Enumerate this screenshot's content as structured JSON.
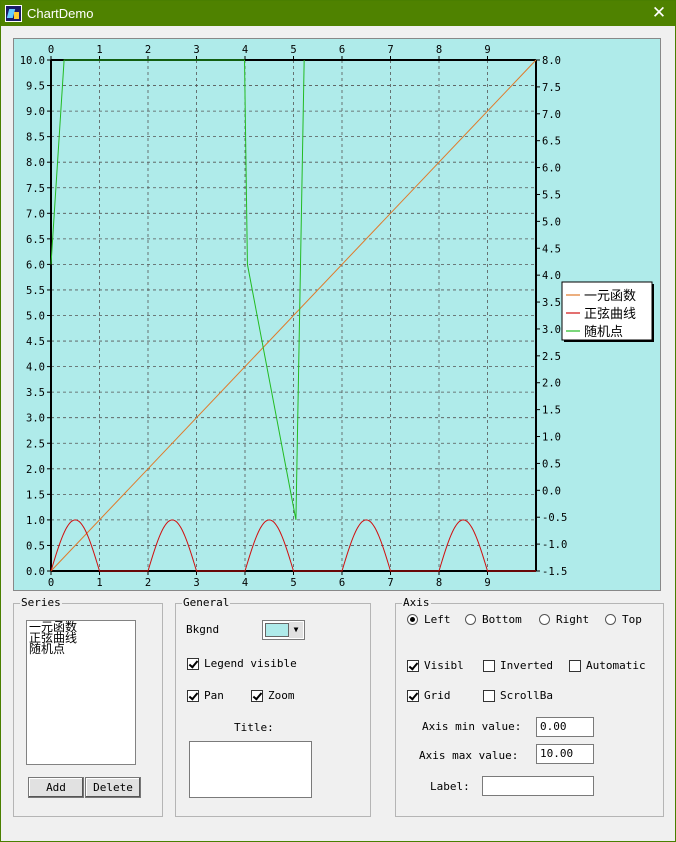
{
  "window": {
    "title": "ChartDemo",
    "close_glyph": "✕"
  },
  "chart_data": {
    "type": "line",
    "title": "",
    "background_color": "#afebea",
    "grid": true,
    "legend_placement": "right",
    "left_axis": {
      "min": 0.0,
      "max": 10.0,
      "ticks": [
        "0.0",
        "0.5",
        "1.0",
        "1.5",
        "2.0",
        "2.5",
        "3.0",
        "3.5",
        "4.0",
        "4.5",
        "5.0",
        "5.5",
        "6.0",
        "6.5",
        "7.0",
        "7.5",
        "8.0",
        "8.5",
        "9.0",
        "9.5",
        "10.0"
      ]
    },
    "right_axis": {
      "min": -1.5,
      "max": 8.0,
      "ticks": [
        "-1.5",
        "-1.0",
        "-0.5",
        "0.0",
        "0.5",
        "1.0",
        "1.5",
        "2.0",
        "2.5",
        "3.0",
        "3.5",
        "4.0",
        "4.5",
        "5.0",
        "5.5",
        "6.0",
        "6.5",
        "7.0",
        "7.5",
        "8.0"
      ]
    },
    "bottom_axis": {
      "min": 0,
      "max": 10,
      "ticks": [
        "0",
        "1",
        "2",
        "3",
        "4",
        "5",
        "6",
        "7",
        "8",
        "9"
      ]
    },
    "top_axis": {
      "min": 0,
      "max": 10,
      "ticks": [
        "0",
        "1",
        "2",
        "3",
        "4",
        "5",
        "6",
        "7",
        "8",
        "9"
      ]
    },
    "series": [
      {
        "name": "一元函数",
        "color": "#e07a2a",
        "x": [
          0,
          10
        ],
        "y": [
          0,
          10
        ]
      },
      {
        "name": "正弦曲线",
        "color": "#d01010",
        "function": "abs(sin(pi*x)) where floor(x) is even, else 0",
        "x_range": [
          0,
          10
        ]
      },
      {
        "name": "随机点",
        "color": "#22bb22",
        "x": [
          0.0,
          0.27,
          3.99,
          4.05,
          5.05,
          5.22
        ],
        "y": [
          6.0,
          10.0,
          10.0,
          6.0,
          1.0,
          10.0
        ]
      }
    ]
  },
  "series_panel": {
    "title": "Series",
    "items": [
      "一元函数",
      "正弦曲线",
      "随机点"
    ],
    "add_label": "Add",
    "delete_label": "Delete"
  },
  "general_panel": {
    "title": "General",
    "bkgnd_label": "Bkgnd",
    "bkgnd_color": "#afebea",
    "legend_visible_label": "Legend visible",
    "legend_visible": true,
    "pan_label": "Pan",
    "pan": true,
    "zoom_label": "Zoom",
    "zoom": true,
    "title_label": "Title:",
    "title_value": ""
  },
  "axis_panel": {
    "title": "Axis",
    "radio_left": "Left",
    "radio_bottom": "Bottom",
    "radio_right": "Right",
    "radio_top": "Top",
    "selected": "Left",
    "visible_label": "Visibl",
    "visible": true,
    "inverted_label": "Inverted",
    "inverted": false,
    "automatic_label": "Automatic",
    "automatic": false,
    "grid_label": "Grid",
    "grid": true,
    "scrollbar_label": "ScrollBa",
    "scrollbar": false,
    "min_label": "Axis min value:",
    "min_value": "0.00",
    "max_label": "Axis max value:",
    "max_value": "10.00",
    "label_label": "Label:",
    "label_value": ""
  }
}
